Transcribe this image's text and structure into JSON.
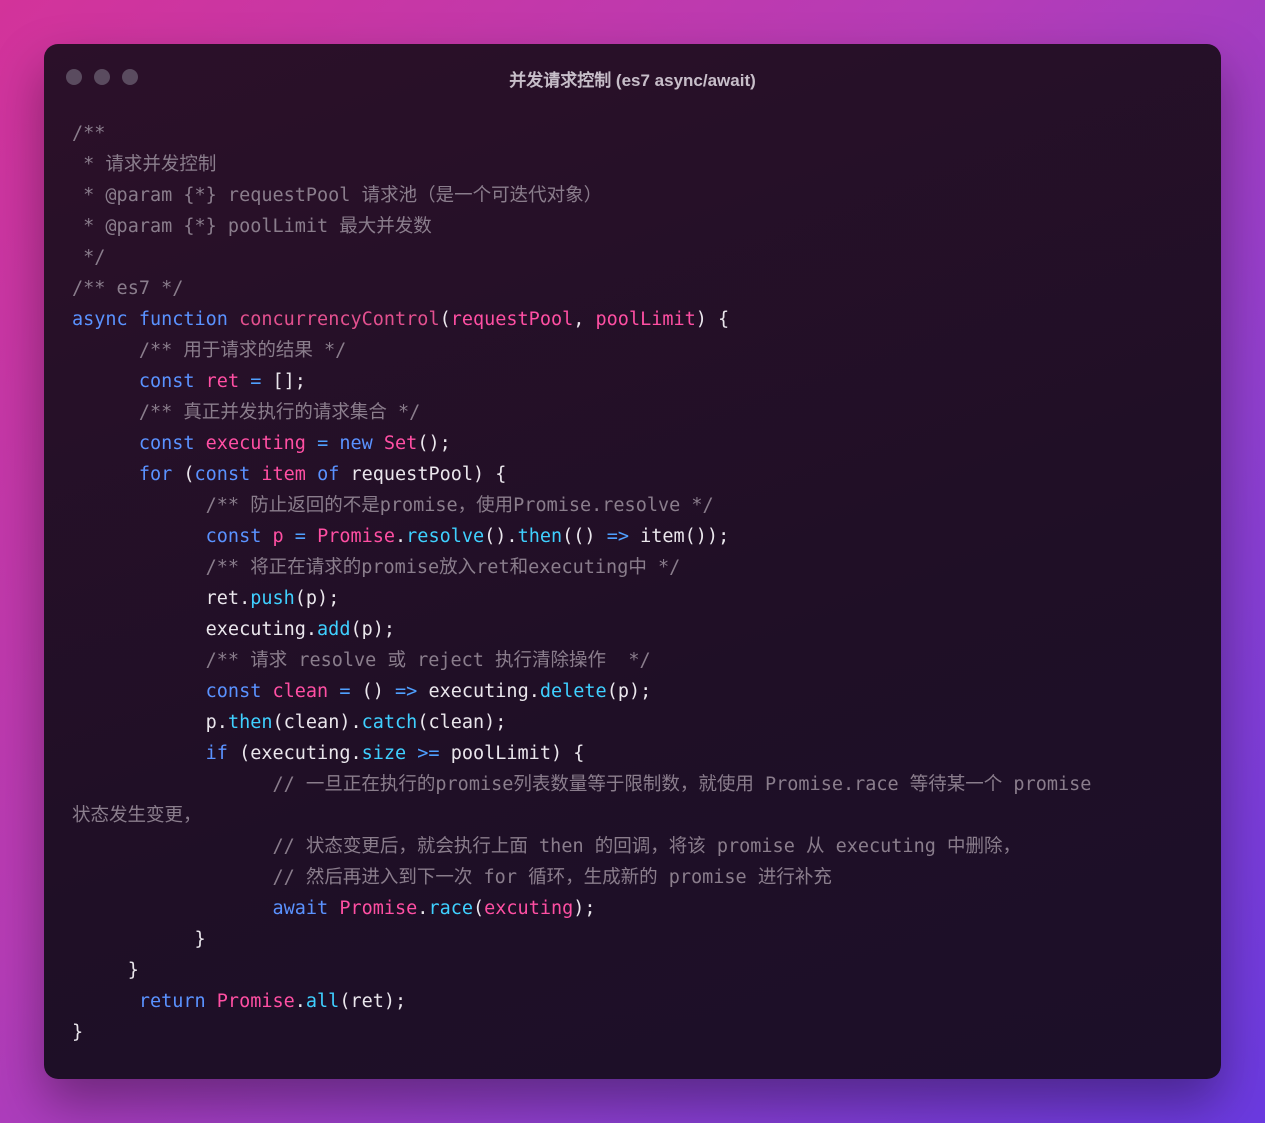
{
  "window": {
    "title": "并发请求控制 (es7 async/await)",
    "dot_color": "#5a4b5f"
  },
  "colors": {
    "background_gradient": [
      "#d3339a",
      "#6a3ae0"
    ],
    "window_bg": "#1f0f26",
    "comment": "#8a7d8c",
    "keyword": "#5a92ff",
    "function_name": "#e3508f",
    "param": "#ff4fa3",
    "method": "#3fd0ff"
  },
  "code": {
    "lines": [
      [
        [
          "cm",
          "/**"
        ]
      ],
      [
        [
          "cm",
          " * 请求并发控制"
        ]
      ],
      [
        [
          "cm",
          " * @param {*} requestPool 请求池（是一个可迭代对象）"
        ]
      ],
      [
        [
          "cm",
          " * @param {*} poolLimit 最大并发数"
        ]
      ],
      [
        [
          "cm",
          " */"
        ]
      ],
      [
        [
          "cm",
          "/** es7 */"
        ]
      ],
      [
        [
          "kw",
          "async"
        ],
        [
          "",
          " "
        ],
        [
          "kw",
          "function"
        ],
        [
          "",
          " "
        ],
        [
          "fn",
          "concurrencyControl"
        ],
        [
          "",
          "("
        ],
        [
          "pr",
          "requestPool"
        ],
        [
          "",
          ", "
        ],
        [
          "pr",
          "poolLimit"
        ],
        [
          "",
          ") {"
        ]
      ],
      [
        [
          "",
          "      "
        ],
        [
          "cm",
          "/** 用于请求的结果 */"
        ]
      ],
      [
        [
          "",
          "      "
        ],
        [
          "kw",
          "const"
        ],
        [
          "",
          " "
        ],
        [
          "pr",
          "ret"
        ],
        [
          "",
          " "
        ],
        [
          "op",
          "="
        ],
        [
          "",
          " [];"
        ]
      ],
      [
        [
          "",
          "      "
        ],
        [
          "cm",
          "/** 真正并发执行的请求集合 */"
        ]
      ],
      [
        [
          "",
          "      "
        ],
        [
          "kw",
          "const"
        ],
        [
          "",
          " "
        ],
        [
          "pr",
          "executing"
        ],
        [
          "",
          " "
        ],
        [
          "op",
          "="
        ],
        [
          "",
          " "
        ],
        [
          "kw",
          "new"
        ],
        [
          "",
          " "
        ],
        [
          "pr",
          "Set"
        ],
        [
          "",
          "();"
        ]
      ],
      [
        [
          "",
          "      "
        ],
        [
          "kw",
          "for"
        ],
        [
          "",
          " ("
        ],
        [
          "kw",
          "const"
        ],
        [
          "",
          " "
        ],
        [
          "pr",
          "item"
        ],
        [
          "",
          " "
        ],
        [
          "kw",
          "of"
        ],
        [
          "",
          " requestPool) {"
        ]
      ],
      [
        [
          "",
          "            "
        ],
        [
          "cm",
          "/** 防止返回的不是promise，使用Promise.resolve */"
        ]
      ],
      [
        [
          "",
          "            "
        ],
        [
          "kw",
          "const"
        ],
        [
          "",
          " "
        ],
        [
          "pr",
          "p"
        ],
        [
          "",
          " "
        ],
        [
          "op",
          "="
        ],
        [
          "",
          " "
        ],
        [
          "pr",
          "Promise"
        ],
        [
          "",
          "."
        ],
        [
          "me",
          "resolve"
        ],
        [
          "",
          "()."
        ],
        [
          "me",
          "then"
        ],
        [
          "",
          "(() "
        ],
        [
          "op",
          "=>"
        ],
        [
          "",
          " item());"
        ]
      ],
      [
        [
          "",
          "            "
        ],
        [
          "cm",
          "/** 将正在请求的promise放入ret和executing中 */"
        ]
      ],
      [
        [
          "",
          "            ret."
        ],
        [
          "me",
          "push"
        ],
        [
          "",
          "(p);"
        ]
      ],
      [
        [
          "",
          "            executing."
        ],
        [
          "me",
          "add"
        ],
        [
          "",
          "(p);"
        ]
      ],
      [
        [
          "",
          "            "
        ],
        [
          "cm",
          "/** 请求 resolve 或 reject 执行清除操作  */"
        ]
      ],
      [
        [
          "",
          "            "
        ],
        [
          "kw",
          "const"
        ],
        [
          "",
          " "
        ],
        [
          "pr",
          "clean"
        ],
        [
          "",
          " "
        ],
        [
          "op",
          "="
        ],
        [
          "",
          " () "
        ],
        [
          "op",
          "=>"
        ],
        [
          "",
          " executing."
        ],
        [
          "me",
          "delete"
        ],
        [
          "",
          "(p);"
        ]
      ],
      [
        [
          "",
          "            p."
        ],
        [
          "me",
          "then"
        ],
        [
          "",
          "(clean)."
        ],
        [
          "me",
          "catch"
        ],
        [
          "",
          "(clean);"
        ]
      ],
      [
        [
          "",
          "            "
        ],
        [
          "kw",
          "if"
        ],
        [
          "",
          " (executing."
        ],
        [
          "me",
          "size"
        ],
        [
          "",
          " "
        ],
        [
          "op",
          ">="
        ],
        [
          "",
          " poolLimit) {"
        ]
      ],
      [
        [
          "",
          "                  "
        ],
        [
          "cm",
          "// 一旦正在执行的promise列表数量等于限制数，就使用 Promise.race 等待某一个 promise"
        ]
      ],
      [
        [
          "cm",
          "状态发生变更，"
        ]
      ],
      [
        [
          "",
          "                  "
        ],
        [
          "cm",
          "// 状态变更后，就会执行上面 then 的回调，将该 promise 从 executing 中删除，"
        ]
      ],
      [
        [
          "",
          "                  "
        ],
        [
          "cm",
          "// 然后再进入到下一次 for 循环，生成新的 promise 进行补充"
        ]
      ],
      [
        [
          "",
          "                  "
        ],
        [
          "kw",
          "await"
        ],
        [
          "",
          " "
        ],
        [
          "pr",
          "Promise"
        ],
        [
          "",
          "."
        ],
        [
          "me",
          "race"
        ],
        [
          "",
          "("
        ],
        [
          "pr",
          "excuting"
        ],
        [
          "",
          ");"
        ]
      ],
      [
        [
          "",
          "           }"
        ]
      ],
      [
        [
          "",
          "     }"
        ]
      ],
      [
        [
          "",
          "      "
        ],
        [
          "kw",
          "return"
        ],
        [
          "",
          " "
        ],
        [
          "pr",
          "Promise"
        ],
        [
          "",
          "."
        ],
        [
          "me",
          "all"
        ],
        [
          "",
          "(ret);"
        ]
      ],
      [
        [
          "",
          "}"
        ]
      ]
    ]
  }
}
